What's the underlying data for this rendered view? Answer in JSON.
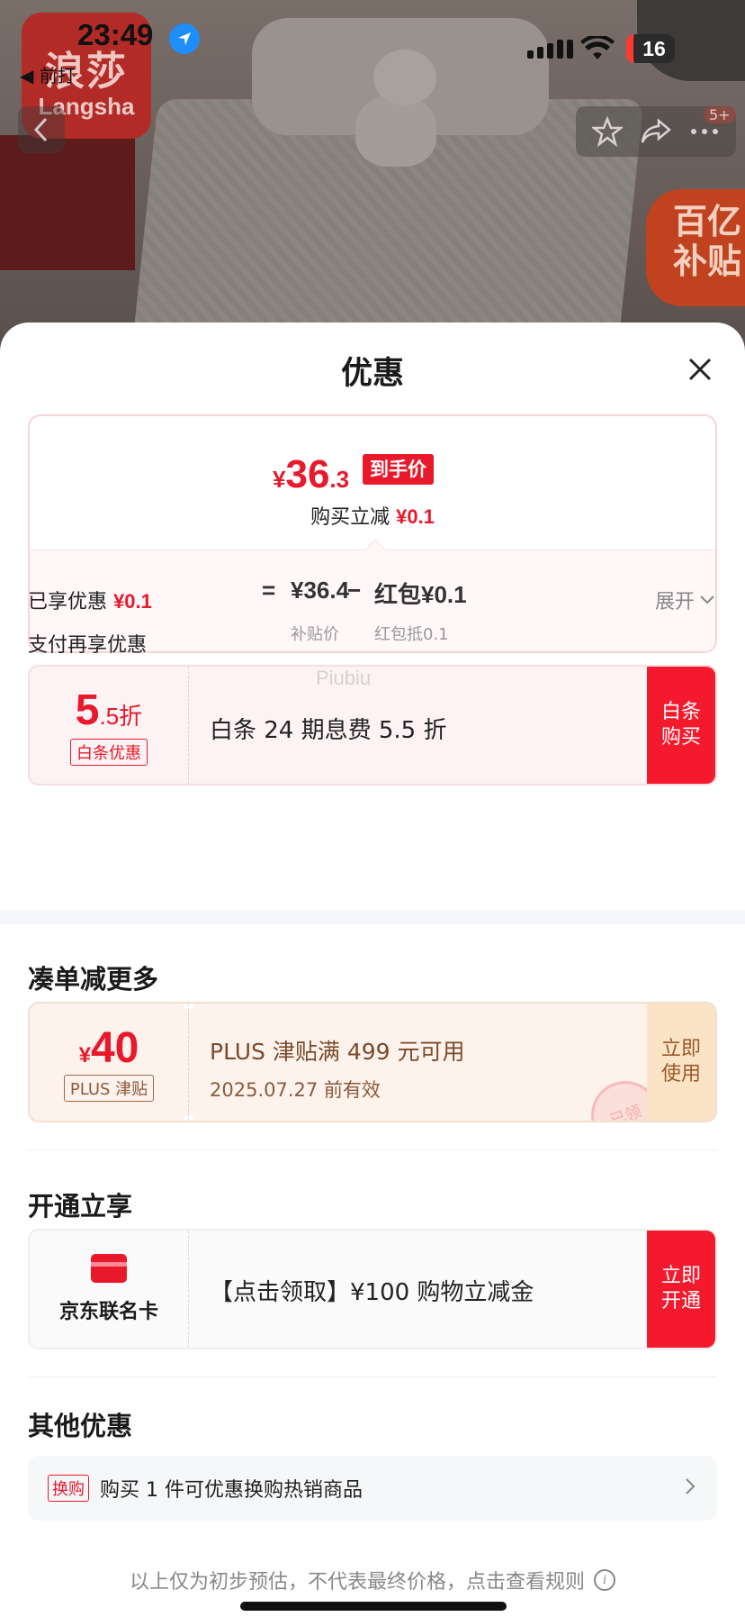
{
  "status_bar": {
    "time": "23:49",
    "back_app": "◀ 前打",
    "battery": "16"
  },
  "brand": {
    "logo_cn": "浪莎",
    "logo_en": "Langsha",
    "subsidy_badge": "百亿补贴",
    "message_count": "5+"
  },
  "sheet": {
    "title": "优惠",
    "price": {
      "yen": "¥",
      "integer": "36",
      "decimal": ".3",
      "tag": "到手价",
      "instant_off_label": "购买立减",
      "instant_off_value": "¥0.1",
      "equals": "=",
      "base_price": "¥36.4",
      "minus": "−",
      "red_packet": "红包¥0.1",
      "base_caption": "补贴价",
      "red_packet_caption": "红包抵0.1"
    },
    "enjoyed_label": "已享优惠",
    "enjoyed_value": "¥0.1",
    "expand_label": "展开",
    "pay_more_label": "支付再享优惠",
    "baitiao": {
      "num": "5",
      "unit": ".5折",
      "tag": "白条优惠",
      "desc": "白条 24 期息费 5.5 折",
      "action": "白条购买",
      "watermark": "Piubiu"
    },
    "section_more": "凑单减更多",
    "plus": {
      "yen": "¥",
      "amount": "40",
      "tag": "PLUS 津贴",
      "desc": "PLUS 津贴满 499 元可用",
      "expiry": "2025.07.27 前有效",
      "action": "立即使用",
      "stamp": "已领"
    },
    "section_open": "开通立享",
    "card": {
      "label": "京东联名卡",
      "desc": "【点击领取】¥100 购物立减金",
      "action": "立即开通"
    },
    "section_other": "其他优惠",
    "other": {
      "tag": "换购",
      "text": "购买 1 件可优惠换购热销商品"
    },
    "disclaimer": "以上仅为初步预估，不代表最终价格，点击查看规则",
    "info_glyph": "i"
  }
}
